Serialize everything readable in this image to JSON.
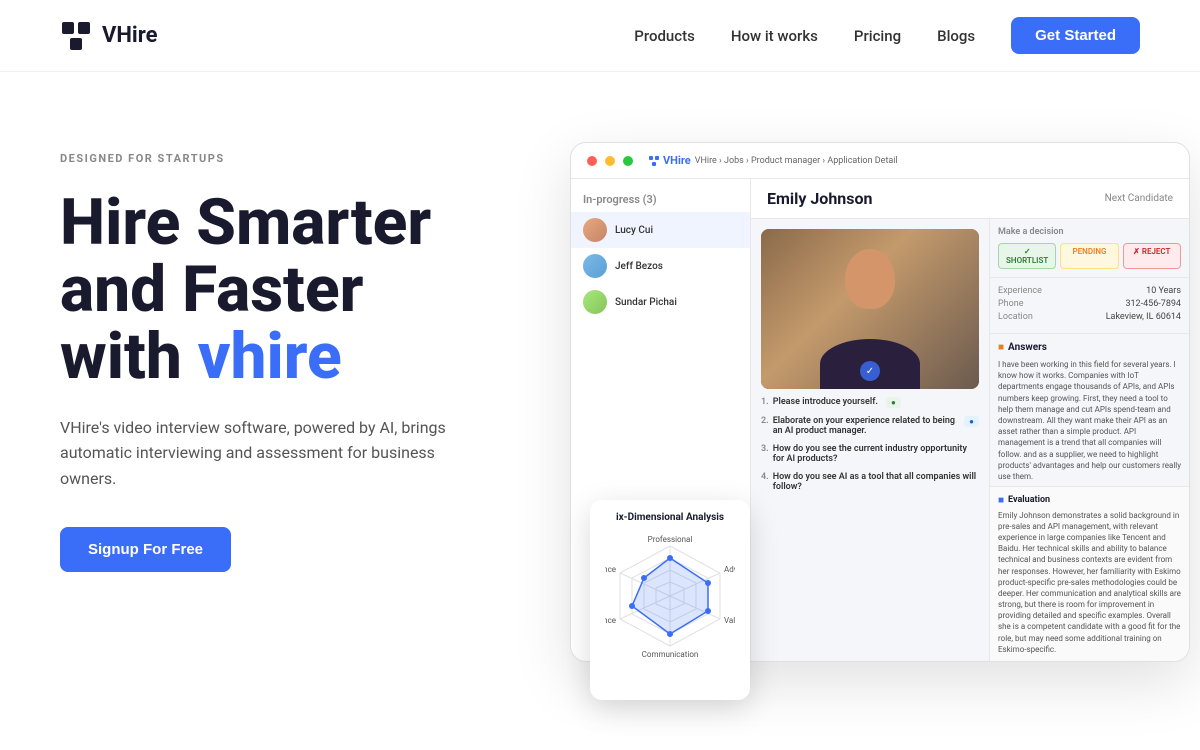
{
  "brand": {
    "logo_text": "VHire",
    "logo_icon": "◆"
  },
  "nav": {
    "links": [
      {
        "id": "products",
        "label": "Products"
      },
      {
        "id": "how-it-works",
        "label": "How it works"
      },
      {
        "id": "pricing",
        "label": "Pricing"
      },
      {
        "id": "blogs",
        "label": "Blogs"
      }
    ],
    "cta_label": "Get Started"
  },
  "hero": {
    "label": "DESIGNED FOR STARTUPS",
    "title_line1": "Hire Smarter",
    "title_line2": "and Faster",
    "title_line3_prefix": "with ",
    "title_line3_accent": "vhire",
    "description": "VHire's video interview software, powered by AI, brings automatic interviewing and assessment for business owners.",
    "cta_label": "Signup For Free"
  },
  "dashboard": {
    "breadcrumb": "VHire  ›  Jobs  ›  Product manager  ›  Application Detail",
    "window_controls": [
      "●",
      "●",
      "●"
    ],
    "candidate_name": "Emily Johnson",
    "next_label": "Next Candidate",
    "status": "In-progress (3)",
    "candidates": [
      {
        "name": "Lucy Cui",
        "color": "#e8a87c"
      },
      {
        "name": "Jeff Bezos",
        "color": "#7cb9e8"
      },
      {
        "name": "Sundar Pichai",
        "color": "#a8e87c"
      }
    ],
    "decision": {
      "label": "Make a decision",
      "shortlist": "✓ SHORTLIST",
      "pending": "PENDING",
      "reject": "✗ REJECT"
    },
    "candidate_info": {
      "years": "10 Years",
      "location": "Lakeview, IL 60614",
      "phone": "312-456-7894"
    },
    "questions": [
      {
        "num": "1",
        "text": "Please introduce yourself.",
        "status": "green",
        "status_label": ""
      },
      {
        "num": "2",
        "text": "Elaborate on your experience related to being an AI product manager.",
        "status": "blue",
        "status_label": ""
      },
      {
        "num": "3",
        "text": "How do you see the current industry opportunity for AI products?",
        "status": "",
        "status_label": ""
      },
      {
        "num": "4",
        "text": "How do you see AI as a tool that all companies will follow...",
        "status": "",
        "status_label": ""
      }
    ],
    "answers_title": "Answers",
    "answer_text": "I have been working in this field for several years. I know how it works. Companies with IoT departments engage thousands of APIs, and APIs numbers keep growing. First, they need a tool to help them manage and cut APIs spend-team and downstream. All they want make their API as an asset rather than a simple product. API management is a trend that all companies will follow. and as a supplier, we need to highlight products' advantages and help our customers really use them.",
    "evaluation_title": "Evaluation",
    "evaluation_text": "Emily Johnson demonstrates a solid background in pre-sales and API management, with relevant experience in large companies like Tencent and Baidu. Her technical skills and ability to balance technical and business contexts are evident from her responses. However, her familiarity with Eskimo product-specific pre-sales methodologies could be deeper. Her communication and analytical skills are strong, but there is room for improvement in providing detailed and specific examples. Overall she is a competent candidate with a good fit for the role, but may need some additional training on Eskimo-specific.",
    "spider": {
      "title": "ix-Dimensional Analysis",
      "labels": [
        "Professional",
        "Advantage",
        "Values",
        "Communication",
        "ance"
      ],
      "values": [
        0.7,
        0.65,
        0.6,
        0.75,
        0.5
      ]
    }
  }
}
